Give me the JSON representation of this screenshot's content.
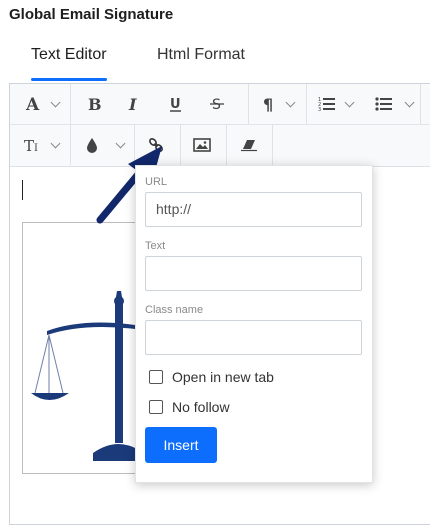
{
  "header": {
    "title": "Global Email Signature"
  },
  "tabs": [
    {
      "label": "Text Editor",
      "active": true
    },
    {
      "label": "Html Format",
      "active": false
    }
  ],
  "toolbar": {
    "row1": [
      "font-icon",
      "bold-icon",
      "italic-icon",
      "underline-icon",
      "strikethrough-icon",
      "paragraph-icon",
      "ordered-list-icon",
      "unordered-list-icon"
    ],
    "row2": [
      "font-size-icon",
      "color-drop-icon",
      "link-icon",
      "image-icon",
      "eraser-icon"
    ]
  },
  "link_popup": {
    "url_label": "URL",
    "url_value": "http://",
    "text_label": "Text",
    "text_value": "",
    "class_label": "Class name",
    "class_value": "",
    "open_new_tab_label": "Open in new tab",
    "open_new_tab_checked": false,
    "no_follow_label": "No follow",
    "no_follow_checked": false,
    "insert_label": "Insert"
  },
  "colors": {
    "accent": "#0d6efd",
    "annotation_arrow": "#12286b",
    "logo": "#1a3a7a"
  }
}
